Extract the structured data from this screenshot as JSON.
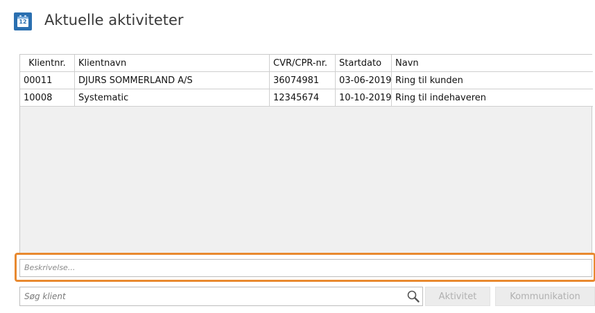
{
  "header": {
    "title": "Aktuelle aktiviteter",
    "icon_label": "12"
  },
  "table": {
    "columns": [
      "Klientnr.",
      "Klientnavn",
      "CVR/CPR-nr.",
      "Startdato",
      "Navn"
    ],
    "rows": [
      [
        "00011",
        "DJURS SOMMERLAND A/S",
        "36074981",
        "03-06-2019",
        "Ring til kunden"
      ],
      [
        "10008",
        "Systematic",
        "12345674",
        "10-10-2019",
        "Ring til indehaveren"
      ]
    ]
  },
  "description": {
    "placeholder": "Beskrivelse..."
  },
  "search": {
    "placeholder": "Søg klient"
  },
  "buttons": {
    "aktivitet": "Aktivitet",
    "kommunikation": "Kommunikation"
  },
  "colors": {
    "highlight": "#e8892f",
    "icon_blue": "#2a6fb0"
  }
}
